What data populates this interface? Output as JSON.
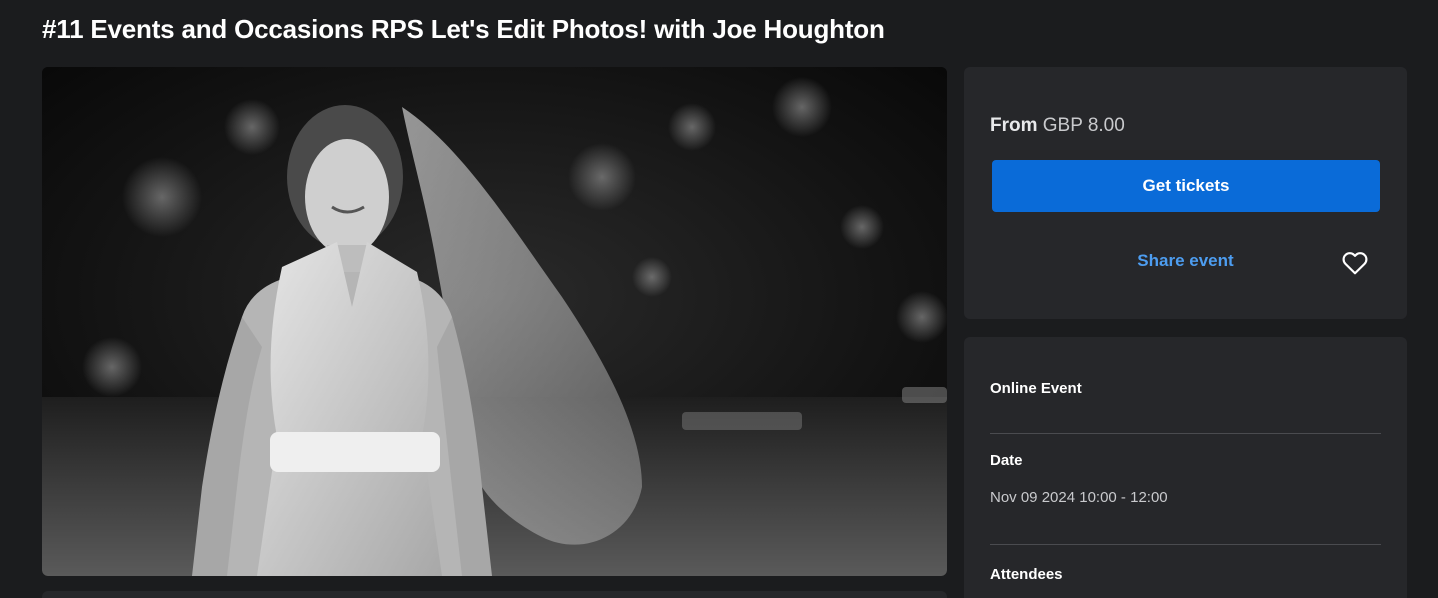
{
  "event": {
    "title": "#11 Events and Occasions RPS Let's Edit Photos! with Joe Houghton"
  },
  "hero_image": {
    "description_icon": "photo-bride-icon"
  },
  "pricing": {
    "from_label": "From",
    "price": "GBP 8.00",
    "get_tickets_label": "Get tickets",
    "share_label": "Share event",
    "favorite_icon": "heart-icon"
  },
  "details": {
    "online_label": "Online Event",
    "date_label": "Date",
    "date_value": "Nov 09 2024 10:00 - 12:00",
    "attendees_label": "Attendees"
  },
  "colors": {
    "background": "#1b1c1e",
    "card": "#26272a",
    "primary_button": "#0a6bd8",
    "link": "#4d9df0"
  }
}
